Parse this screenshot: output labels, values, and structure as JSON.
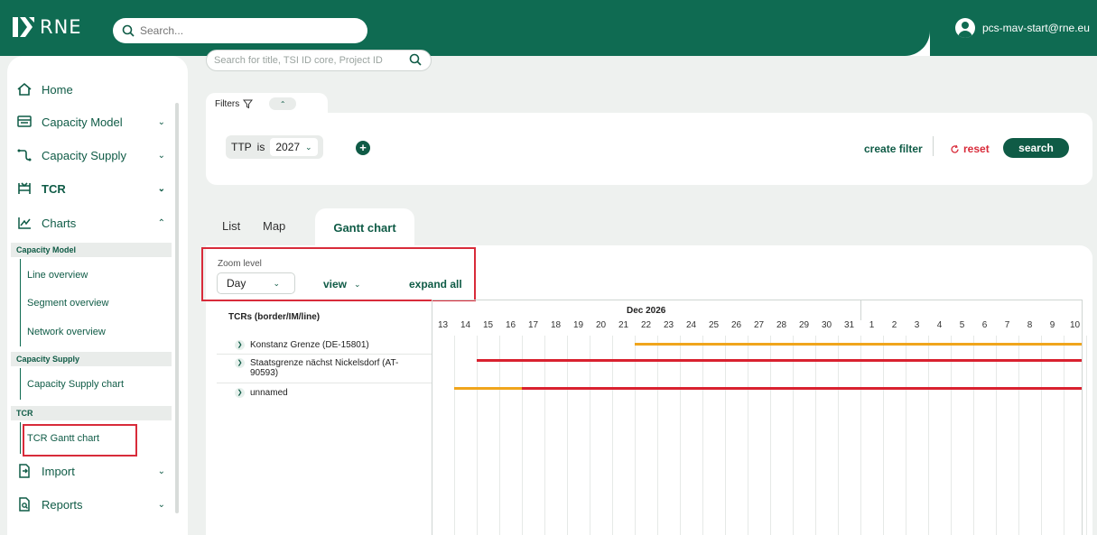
{
  "header": {
    "logo_text": "RNE",
    "search_placeholder": "Search...",
    "user_email": "pcs-mav-start@rne.eu"
  },
  "sidebar": {
    "home": "Home",
    "capacity_model": "Capacity Model",
    "capacity_supply": "Capacity Supply",
    "tcr": "TCR",
    "charts": "Charts",
    "sections": [
      {
        "title": "Capacity Model",
        "items": [
          "Line overview",
          "Segment overview",
          "Network overview"
        ]
      },
      {
        "title": "Capacity Supply",
        "items": [
          "Capacity Supply chart"
        ]
      },
      {
        "title": "TCR",
        "items": [
          "TCR Gantt chart"
        ]
      }
    ],
    "import": "Import",
    "reports": "Reports"
  },
  "main": {
    "search_placeholder": "Search for title, TSI ID core, Project ID",
    "filters_label": "Filters",
    "filter_chip": {
      "field": "TTP",
      "operator": "is",
      "value": "2027"
    },
    "create_filter": "create filter",
    "reset": "reset",
    "search": "search",
    "tabs": [
      "List",
      "Map",
      "Gantt chart"
    ],
    "active_tab": "Gantt chart",
    "zoom_label": "Zoom level",
    "zoom_value": "Day",
    "view_label": "view",
    "expand_all": "expand all"
  },
  "gantt": {
    "left_header": "TCRs (border/IM/line)",
    "month": "Dec 2026",
    "days": [
      "13",
      "14",
      "15",
      "16",
      "17",
      "18",
      "19",
      "20",
      "21",
      "22",
      "23",
      "24",
      "25",
      "26",
      "27",
      "28",
      "29",
      "30",
      "31",
      "1",
      "2",
      "3",
      "4",
      "5",
      "6",
      "7",
      "8",
      "9",
      "10"
    ],
    "rows": [
      {
        "label": "Konstanz Grenze (DE-15801)"
      },
      {
        "label_line1": "Staatsgrenze nächst Nickelsdorf (AT-",
        "label_line2": "90593)"
      },
      {
        "label": "unnamed"
      }
    ],
    "colors": {
      "orange": "#f0a51c",
      "red": "#d9212f",
      "brand": "#0f6b52"
    }
  }
}
